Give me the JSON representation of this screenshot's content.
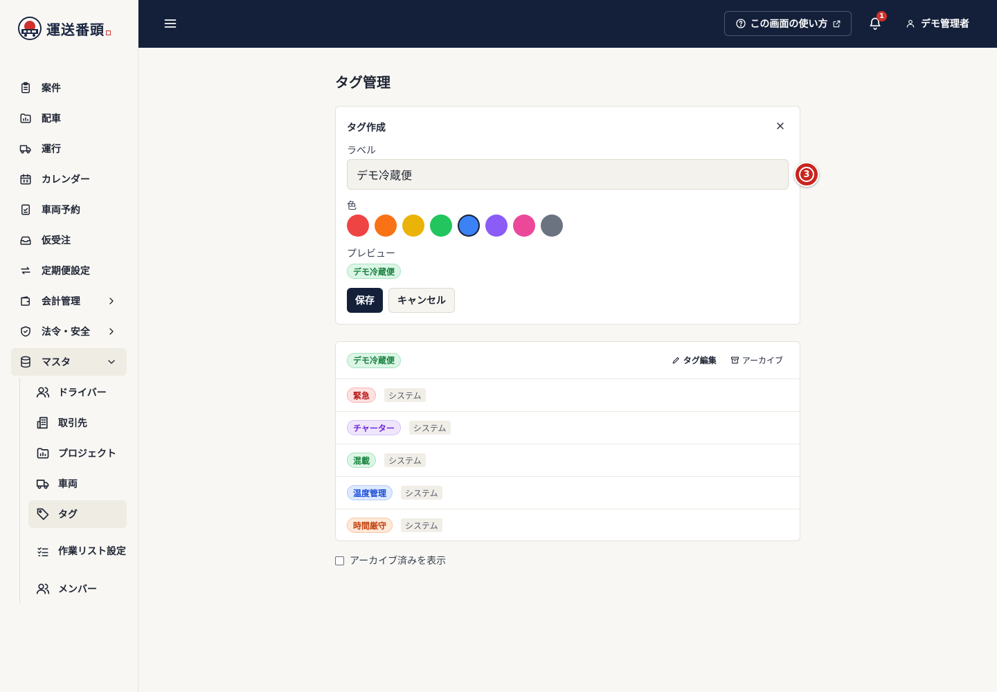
{
  "brand": {
    "name": "運送番頭"
  },
  "header": {
    "help_label": "この画面の使い方",
    "notification_count": "1",
    "user_name": "デモ管理者"
  },
  "sidebar": {
    "items": [
      {
        "label": "案件",
        "icon": "clipboard-icon"
      },
      {
        "label": "配車",
        "icon": "chart-folder-icon"
      },
      {
        "label": "運行",
        "icon": "truck-icon"
      },
      {
        "label": "カレンダー",
        "icon": "calendar-icon"
      },
      {
        "label": "車両予約",
        "icon": "check-clipboard-icon"
      },
      {
        "label": "仮受注",
        "icon": "inbox-icon"
      },
      {
        "label": "定期便設定",
        "icon": "repeat-icon"
      },
      {
        "label": "会計管理",
        "icon": "wallet-icon"
      },
      {
        "label": "法令・安全",
        "icon": "shield-icon"
      },
      {
        "label": "マスタ",
        "icon": "database-icon"
      }
    ],
    "master_items": [
      {
        "label": "ドライバー",
        "icon": "users-icon"
      },
      {
        "label": "取引先",
        "icon": "building-icon"
      },
      {
        "label": "プロジェクト",
        "icon": "chart-folder-icon"
      },
      {
        "label": "車両",
        "icon": "truck-icon"
      },
      {
        "label": "タグ",
        "icon": "tag-icon"
      },
      {
        "label": "作業リスト設定",
        "icon": "list-check-icon"
      },
      {
        "label": "メンバー",
        "icon": "users-icon"
      }
    ]
  },
  "main": {
    "title": "タグ管理",
    "form": {
      "title": "タグ作成",
      "label_caption": "ラベル",
      "label_value": "デモ冷蔵便",
      "color_caption": "色",
      "colors": [
        "#ef4444",
        "#f97316",
        "#eab308",
        "#22c55e",
        "#3b82f6",
        "#8b5cf6",
        "#ec4899",
        "#6b7280"
      ],
      "selected_color": "#3b82f6",
      "preview_caption": "プレビュー",
      "preview_tag": "デモ冷蔵便",
      "save_label": "保存",
      "cancel_label": "キャンセル",
      "step_marker": "3"
    },
    "tags": [
      {
        "label": "デモ冷蔵便",
        "style": "green",
        "system": "",
        "edit_label": "タグ編集",
        "archive_label": "アーカイブ"
      },
      {
        "label": "緊急",
        "style": "red",
        "system": "システム"
      },
      {
        "label": "チャーター",
        "style": "purple",
        "system": "システム"
      },
      {
        "label": "混載",
        "style": "green",
        "system": "システム"
      },
      {
        "label": "温度管理",
        "style": "blue",
        "system": "システム"
      },
      {
        "label": "時間厳守",
        "style": "orange",
        "system": "システム"
      }
    ],
    "show_archived_label": "アーカイブ済みを表示"
  }
}
